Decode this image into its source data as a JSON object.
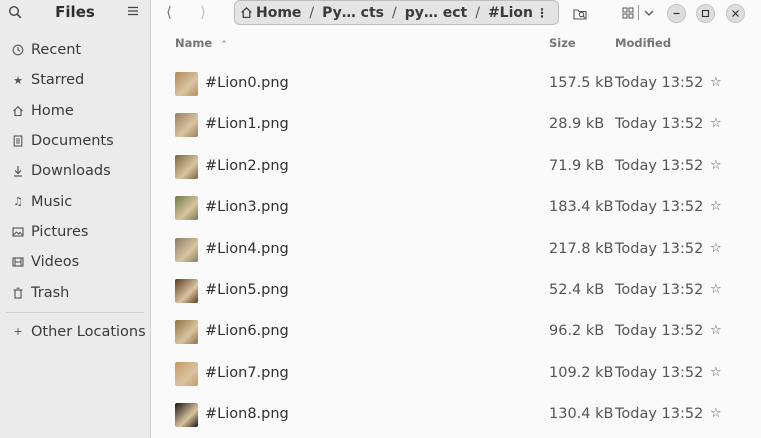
{
  "sidebar": {
    "title": "Files",
    "items": [
      {
        "label": "Recent",
        "icon": "clock-icon"
      },
      {
        "label": "Starred",
        "icon": "star-icon"
      },
      {
        "label": "Home",
        "icon": "home-icon"
      },
      {
        "label": "Documents",
        "icon": "document-icon"
      },
      {
        "label": "Downloads",
        "icon": "download-icon"
      },
      {
        "label": "Music",
        "icon": "music-icon"
      },
      {
        "label": "Pictures",
        "icon": "picture-icon"
      },
      {
        "label": "Videos",
        "icon": "video-icon"
      },
      {
        "label": "Trash",
        "icon": "trash-icon"
      }
    ],
    "other_locations": "Other Locations"
  },
  "pathbar": {
    "crumbs": [
      "Home",
      "Py… cts",
      "py… ect",
      "#Lion"
    ],
    "separator": "/"
  },
  "columns": {
    "name": "Name",
    "size": "Size",
    "modified": "Modified"
  },
  "files": [
    {
      "name": "#Lion0.png",
      "size": "157.5 kB",
      "modified": "Today 13:52",
      "star": "☆",
      "thumb_color": "#b58a5a"
    },
    {
      "name": "#Lion1.png",
      "size": "28.9 kB",
      "modified": "Today 13:52",
      "star": "☆",
      "thumb_color": "#9a7e62"
    },
    {
      "name": "#Lion2.png",
      "size": "71.9 kB",
      "modified": "Today 13:52",
      "star": "☆",
      "thumb_color": "#7a6640"
    },
    {
      "name": "#Lion3.png",
      "size": "183.4 kB",
      "modified": "Today 13:52",
      "star": "☆",
      "thumb_color": "#6f7a4a"
    },
    {
      "name": "#Lion4.png",
      "size": "217.8 kB",
      "modified": "Today 13:52",
      "star": "☆",
      "thumb_color": "#8a7a6a"
    },
    {
      "name": "#Lion5.png",
      "size": "52.4 kB",
      "modified": "Today 13:52",
      "star": "☆",
      "thumb_color": "#5a3a22"
    },
    {
      "name": "#Lion6.png",
      "size": "96.2 kB",
      "modified": "Today 13:52",
      "star": "☆",
      "thumb_color": "#8f7342"
    },
    {
      "name": "#Lion7.png",
      "size": "109.2 kB",
      "modified": "Today 13:52",
      "star": "☆",
      "thumb_color": "#c49a68"
    },
    {
      "name": "#Lion8.png",
      "size": "130.4 kB",
      "modified": "Today 13:52",
      "star": "☆",
      "thumb_color": "#1c1410"
    }
  ]
}
